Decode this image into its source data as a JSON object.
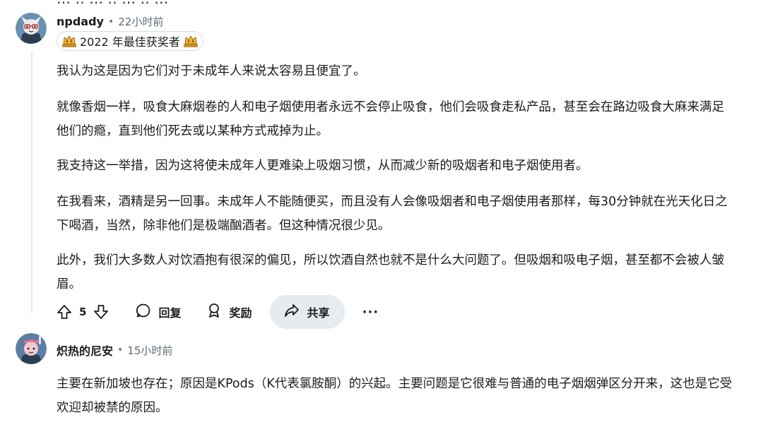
{
  "top_clipped_text": "… ‥ … ‥ … ‥ …",
  "comments": [
    {
      "username": "npdady",
      "separator": "•",
      "time": "22小时前",
      "flair": "2022 年最佳获奖者",
      "paragraphs": [
        "我认为这是因为它们对于未成年人来说太容易且便宜了。",
        "就像香烟一样，吸食大麻烟卷的人和电子烟使用者永远不会停止吸食，他们会吸食走私产品，甚至会在路边吸食大麻来满足他们的瘾，直到他们死去或以某种方式戒掉为止。",
        "我支持这一举措，因为这将使未成年人更难染上吸烟习惯，从而减少新的吸烟者和电子烟使用者。",
        "在我看来，酒精是另一回事。未成年人不能随便买，而且没有人会像吸烟者和电子烟使用者那样，每30分钟就在光天化日之下喝酒，当然，除非他们是极端酗酒者。但这种情况很少见。",
        "此外，我们大多数人对饮酒抱有很深的偏见，所以饮酒自然也就不是什么大问题了。但吸烟和吸电子烟，甚至都不会被人皱眉。"
      ],
      "actions": {
        "vote_count": "5",
        "reply_label": "回复",
        "award_label": "奖励",
        "share_label": "共享",
        "more_label": "···"
      }
    },
    {
      "username": "炽热的尼安",
      "separator": "•",
      "time": "15小时前",
      "paragraphs": [
        "主要在新加坡也存在；原因是KPods（K代表氯胺酮）的兴起。主要问题是它很难与普通的电子烟烟弹区分开来，这也是它受欢迎却被禁的原因。"
      ]
    }
  ],
  "icons": {
    "upvote": "arrow-up-icon",
    "downvote": "arrow-down-icon",
    "reply": "speech-bubble-icon",
    "award": "award-ribbon-icon",
    "share": "share-arrow-icon",
    "more": "ellipsis-icon",
    "flair": "trophy-cat-icon"
  },
  "colors": {
    "text": "#1c1c1c",
    "meta": "#5c6b73",
    "share_bg": "#e5ebee",
    "thread_line": "#e5e7ea"
  }
}
